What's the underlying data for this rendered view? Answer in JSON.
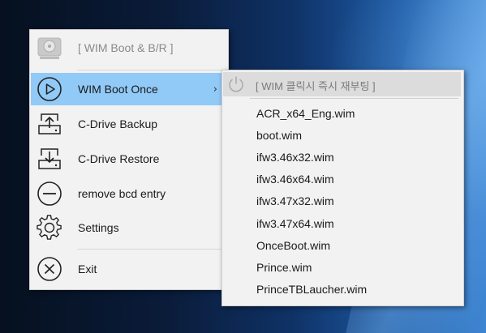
{
  "main_menu": {
    "header_label": "[ WIM Boot & B/R ]",
    "items": [
      {
        "label": "WIM Boot Once",
        "icon": "play-circle-icon",
        "has_submenu": true
      },
      {
        "label": "C-Drive Backup",
        "icon": "drive-upload-icon"
      },
      {
        "label": "C-Drive Restore",
        "icon": "drive-download-icon"
      },
      {
        "label": "remove bcd entry",
        "icon": "minus-circle-icon"
      },
      {
        "label": "Settings",
        "icon": "gear-icon"
      },
      {
        "label": "Exit",
        "icon": "close-circle-icon"
      }
    ],
    "submenu_chevron": "›"
  },
  "submenu": {
    "header_label": "[ WIM 클릭시 즉시 재부팅 ]",
    "header_icon": "power-icon",
    "items": [
      "ACR_x64_Eng.wim",
      "boot.wim",
      "ifw3.46x32.wim",
      "ifw3.46x64.wim",
      "ifw3.47x32.wim",
      "ifw3.47x64.wim",
      "OnceBoot.wim",
      "Prince.wim",
      "PrinceTBLaucher.wim"
    ]
  },
  "colors": {
    "menu_bg": "#f2f2f2",
    "highlight": "#91c9f7",
    "submenu_header_bg": "#dcdcdc"
  }
}
